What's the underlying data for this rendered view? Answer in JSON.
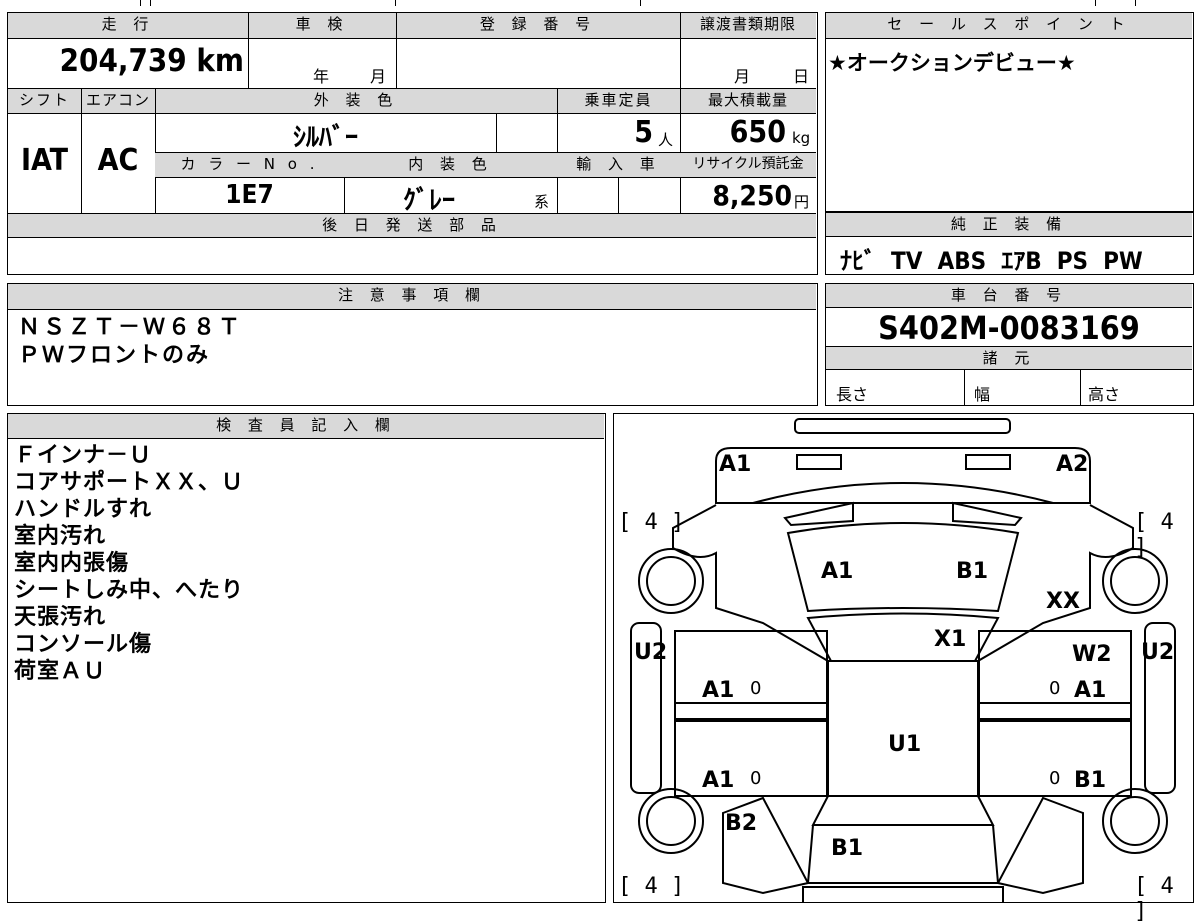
{
  "top_strip": {
    "fragment": "..."
  },
  "main_table": {
    "mileage_header": "走 行",
    "inspection_header": "車 検",
    "registration_header": "登 録 番 号",
    "transfer_header": "譲渡書類期限",
    "mileage_value": "204,739 km",
    "inspection_year": "年",
    "inspection_month": "月",
    "transfer_month": "月",
    "transfer_day": "日",
    "shift_header": "シフト",
    "ac_header": "エアコン",
    "exterior_header": "外 装 色",
    "capacity_header": "乗車定員",
    "load_header": "最大積載量",
    "shift_value": "IAT",
    "ac_value": "AC",
    "exterior_value": "ｼﾙﾊﾞｰ",
    "capacity_value": "5",
    "capacity_unit": "人",
    "load_value": "650",
    "load_unit": "kg",
    "color_no_header": "カ ラ ー N o .",
    "interior_header": "内 装 色",
    "import_header": "輸 入 車",
    "recycle_header": "リサイクル預託金",
    "color_no_value": "1E7",
    "interior_value": "ｸﾞﾚｰ",
    "interior_suffix": "系",
    "recycle_value": "8,250",
    "recycle_unit": "円",
    "later_parts_header": "後 日 発 送 部 品"
  },
  "sales_point": {
    "header": "セ ー ル ス ポ イ ン ト",
    "text": "★オークションデビュー★"
  },
  "genuine_equipment": {
    "header": "純 正 装 備",
    "text": "ﾅﾋﾞ  TV  ABS  ｴｱB  PS  PW"
  },
  "notes": {
    "header": "注 意 事 項 欄",
    "lines": [
      "ＮＳＺＴ－Ｗ６８Ｔ",
      "ＰＷフロントのみ"
    ]
  },
  "chassis": {
    "header": "車 台 番 号",
    "value": "S402M-0083169"
  },
  "specs": {
    "header": "諸 元",
    "length": "長さ",
    "width": "幅",
    "height": "高さ"
  },
  "inspector": {
    "header": "検 査 員 記 入 欄",
    "lines": [
      "Ｆインナ－Ｕ",
      "コアサポートＸＸ、Ｕ",
      "ハンドルすれ",
      "室内汚れ",
      "室内内張傷",
      "シートしみ中、へたり",
      "天張汚れ",
      "コンソール傷",
      "荷室ＡＵ"
    ]
  },
  "diagram": {
    "tire_labels": [
      "[ 4 ]",
      "[ 4 ]",
      "[ 4 ]",
      "[ 4 ]"
    ],
    "marks": {
      "a1_front_left": "A1",
      "a2_front_right": "A2",
      "a1_hood": "A1",
      "b1_hood": "B1",
      "xx": "XX",
      "x1": "X1",
      "u2_left": "U2",
      "u2_right": "U2",
      "w2": "W2",
      "a1_door_fl": "A1",
      "a1_door_fr": "A1",
      "u1": "U1",
      "a1_door_rl": "A1",
      "b1_door_rr": "B1",
      "b2": "B2",
      "b1_rear": "B1",
      "zero": "0"
    }
  }
}
